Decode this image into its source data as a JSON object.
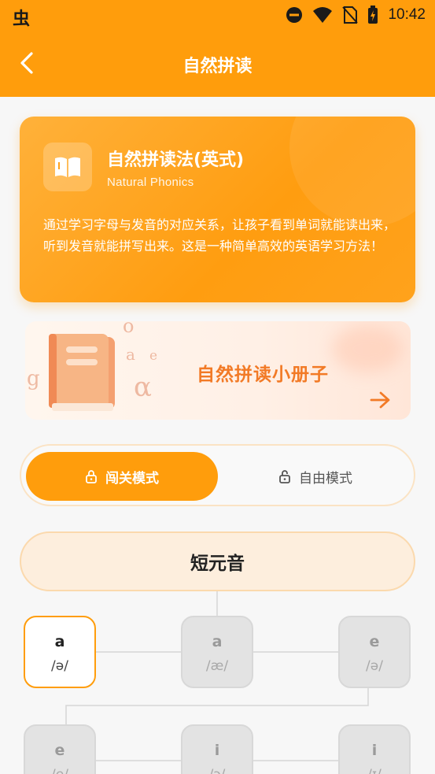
{
  "status_bar": {
    "time": "10:42",
    "app_icon": "虫"
  },
  "header": {
    "title": "自然拼读",
    "back_icon": "chevron-left-icon"
  },
  "intro": {
    "title": "自然拼读法(英式)",
    "subtitle": "Natural Phonics",
    "description": "通过学习字母与发音的对应关系，让孩子看到单词就能读出来，听到发音就能拼写出来。这是一种简单高效的英语学习方法！",
    "icon": "open-book-icon"
  },
  "banner": {
    "label": "自然拼读小册子",
    "decor_letters": [
      "g",
      "e",
      "α",
      "o",
      "a"
    ]
  },
  "modes": {
    "challenge_label": "闯关模式",
    "free_label": "自由模式",
    "active": "challenge"
  },
  "section": {
    "title": "短元音"
  },
  "lessons": [
    {
      "letter": "a",
      "phonetic": "/ə/",
      "state": "active"
    },
    {
      "letter": "a",
      "phonetic": "/æ/",
      "state": "locked"
    },
    {
      "letter": "e",
      "phonetic": "/ə/",
      "state": "locked"
    },
    {
      "letter": "e",
      "phonetic": "/e/",
      "state": "locked"
    },
    {
      "letter": "i",
      "phonetic": "/ɔ/",
      "state": "locked"
    },
    {
      "letter": "i",
      "phonetic": "/ɪ/",
      "state": "locked"
    }
  ],
  "colors": {
    "brand": "#ff9d0c",
    "banner_text": "#f27a26",
    "pill_bg": "#fdeedd"
  }
}
